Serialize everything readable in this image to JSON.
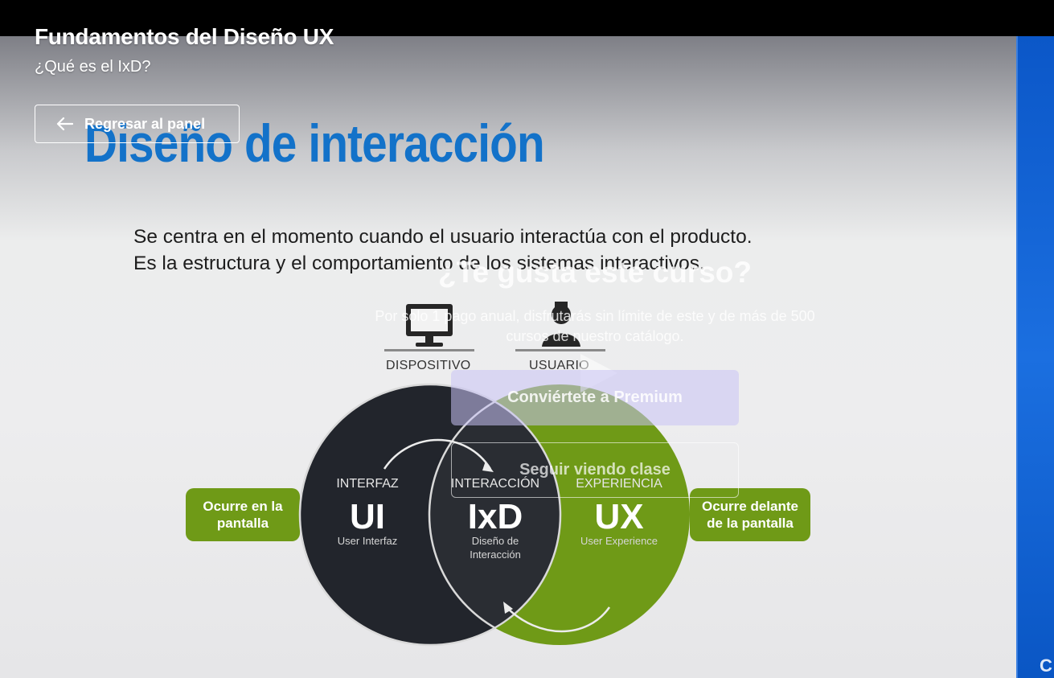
{
  "header": {
    "course_title": "Fundamentos del Diseño UX",
    "lesson_title": "¿Qué es el IxD?",
    "back_label": "Regresar al panel"
  },
  "slide": {
    "title": "Diseño de interacción",
    "description": [
      "Se centra en el momento cuando el usuario interactúa con el producto.",
      "Es la estructura y el comportamiento de los sistemas interactivos."
    ],
    "device_label": "DISPOSITIVO",
    "user_label": "USUARIO",
    "left_note": "Ocurre en la pantalla",
    "right_note": "Ocurre delante de la pantalla",
    "ui": {
      "caption": "INTERFAZ",
      "abbr": "UI",
      "sub": "User Interfaz"
    },
    "ixd": {
      "caption": "INTERACCIÓN",
      "abbr": "IxD",
      "sub": "Diseño de Interacción"
    },
    "ux": {
      "caption": "EXPERIENCIA",
      "abbr": "UX",
      "sub": "User Experience"
    },
    "colors": {
      "title": "#1372c9",
      "dark_circle": "#22252c",
      "green": "#6f9a17"
    }
  },
  "promo": {
    "heading": "¿Te gusta este curso?",
    "text": "Por solo 1 pago anual, disfrutarás sin límite de este y de más de 500 cursos de nuestro catálogo.",
    "premium_label": "Conviértete a Premium",
    "continue_label": "Seguir viendo clase"
  },
  "icons": {
    "back": "arrow-left-icon",
    "play": "play-icon",
    "device": "monitor-icon",
    "user": "user-icon"
  }
}
